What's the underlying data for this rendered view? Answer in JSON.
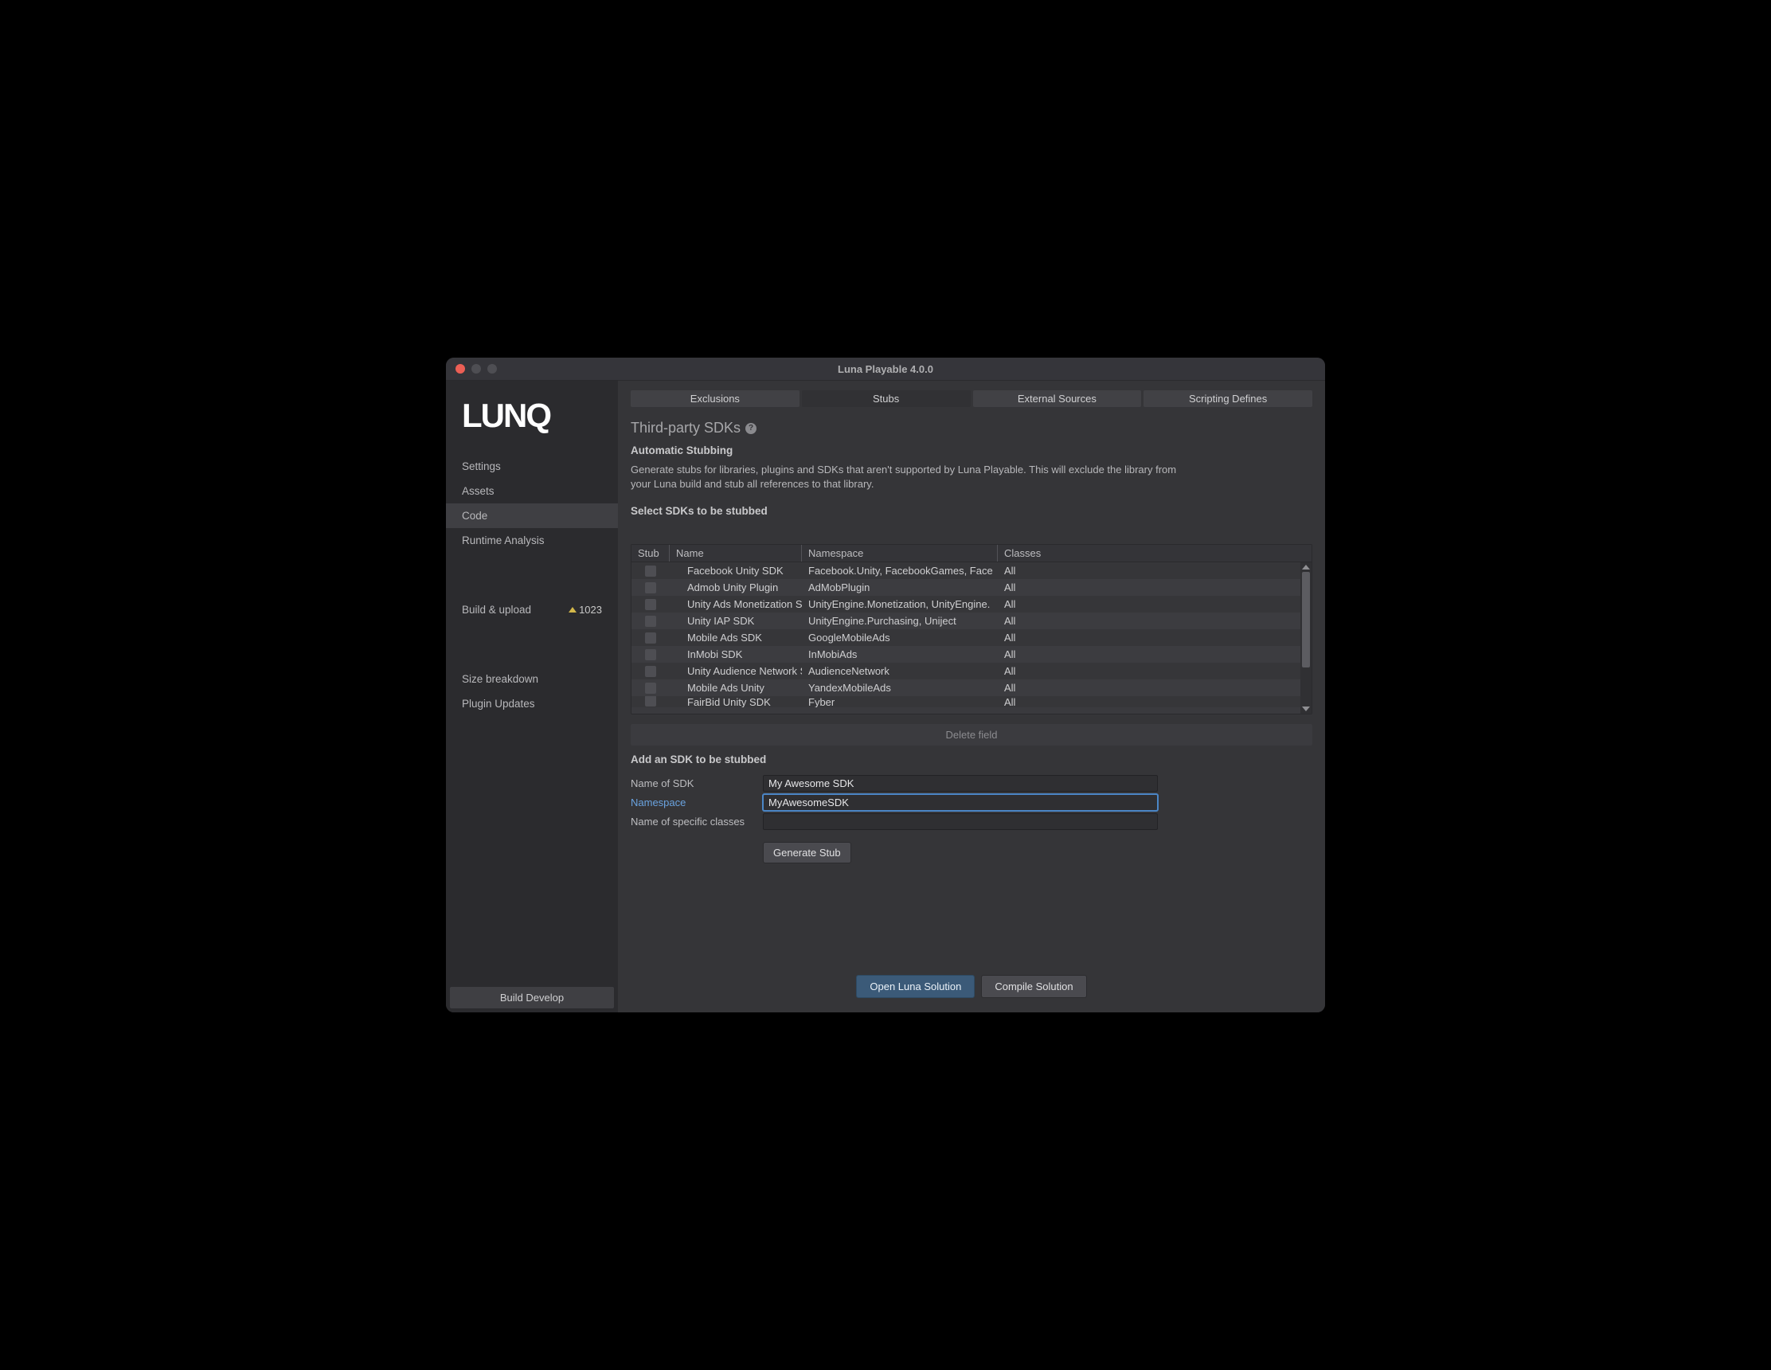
{
  "window": {
    "title": "Luna Playable 4.0.0"
  },
  "logo_text": "Luna",
  "sidebar": {
    "items": [
      {
        "label": "Settings"
      },
      {
        "label": "Assets"
      },
      {
        "label": "Code"
      },
      {
        "label": "Runtime Analysis"
      }
    ],
    "build_upload": {
      "label": "Build & upload",
      "badge": "1023"
    },
    "lower": [
      {
        "label": "Size breakdown"
      },
      {
        "label": "Plugin Updates"
      }
    ],
    "footer_button": "Build Develop"
  },
  "tabs": [
    {
      "label": "Exclusions"
    },
    {
      "label": "Stubs"
    },
    {
      "label": "External Sources"
    },
    {
      "label": "Scripting Defines"
    }
  ],
  "section": {
    "title": "Third-party SDKs",
    "sub": "Automatic Stubbing",
    "desc": "Generate stubs for libraries, plugins and SDKs that aren't supported by Luna Playable. This will exclude the library from your Luna build and stub all references to that library.",
    "select_label": "Select SDKs to be stubbed"
  },
  "grid": {
    "headers": {
      "stub": "Stub",
      "name": "Name",
      "ns": "Namespace",
      "cls": "Classes"
    },
    "rows": [
      {
        "name": "Facebook Unity SDK",
        "ns": "Facebook.Unity, FacebookGames, Face",
        "cls": "All"
      },
      {
        "name": "Admob Unity Plugin",
        "ns": "AdMobPlugin",
        "cls": "All"
      },
      {
        "name": "Unity Ads Monetization SDK",
        "ns": "UnityEngine.Monetization, UnityEngine.",
        "cls": "All"
      },
      {
        "name": "Unity IAP SDK",
        "ns": "UnityEngine.Purchasing, Uniject",
        "cls": "All"
      },
      {
        "name": "Mobile Ads SDK",
        "ns": "GoogleMobileAds",
        "cls": "All"
      },
      {
        "name": "InMobi SDK",
        "ns": "InMobiAds",
        "cls": "All"
      },
      {
        "name": "Unity Audience Network SDK",
        "ns": "AudienceNetwork",
        "cls": "All"
      },
      {
        "name": "Mobile Ads Unity",
        "ns": "YandexMobileAds",
        "cls": "All"
      },
      {
        "name": "FairBid Unity SDK",
        "ns": "Fyber",
        "cls": "All"
      }
    ],
    "delete_label": "Delete field"
  },
  "add": {
    "heading": "Add an SDK to be stubbed",
    "name_label": "Name of SDK",
    "name_value": "My Awesome SDK",
    "ns_label": "Namespace",
    "ns_value": "MyAwesomeSDK",
    "cls_label": "Name of specific classes",
    "cls_value": "",
    "generate": "Generate Stub"
  },
  "footer": {
    "open": "Open Luna Solution",
    "compile": "Compile Solution"
  }
}
